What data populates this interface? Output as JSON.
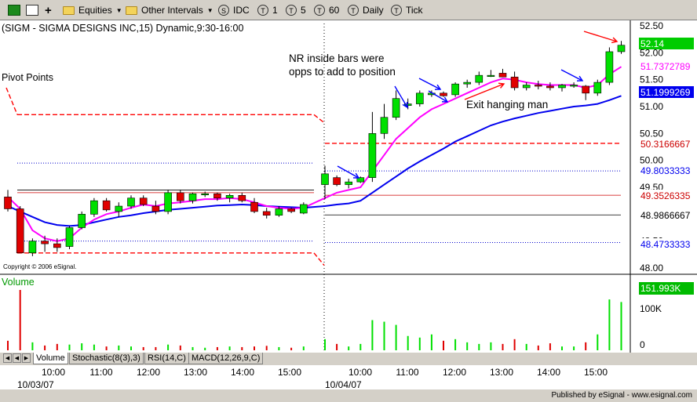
{
  "toolbar": {
    "equities_label": "Equities",
    "other_intervals_label": "Other Intervals",
    "idc_label": "IDC",
    "intervals": [
      "1",
      "5",
      "60",
      "Daily",
      "Tick"
    ],
    "icons": [
      "chart-window-icon",
      "page-setup-icon",
      "add-icon",
      "folder-icon",
      "source-icon",
      "interval-icon"
    ]
  },
  "chart": {
    "title": "(SIGM - SIGMA DESIGNS INC,15) Dynamic,9:30-16:00",
    "pivot_label": "Pivot Points",
    "copyright": "Copyright © 2006 eSignal.",
    "volume_label": "Volume",
    "annotations": [
      "NR inside bars were",
      "opps to add to position",
      "Exit hanging man"
    ],
    "colors": {
      "up": "#00e000",
      "down": "#e00000",
      "ma_fast": "#ff00ff",
      "ma_slow": "#0000ee",
      "pivot_red": "#ff0000",
      "pivot_blue": "#0000cc",
      "arrow_blue": "#0000ff",
      "arrow_red": "#ff0000",
      "volume_label": "#009900"
    }
  },
  "chart_data": {
    "type": "candlestick",
    "symbol": "SIGM",
    "interval": "15",
    "x_labels": [
      "10:00",
      "11:00",
      "12:00",
      "13:00",
      "14:00",
      "15:00",
      "10:00",
      "11:00",
      "12:00",
      "13:00",
      "14:00",
      "15:00"
    ],
    "date_labels": [
      "10/03/07",
      "10/04/07"
    ],
    "y_ticks": [
      "52.50",
      "52.00",
      "51.50",
      "51.00",
      "50.50",
      "50.00",
      "49.50",
      "49.00",
      "48.50",
      "48.00"
    ],
    "ylim": [
      48.0,
      52.6
    ],
    "volume_ticks": [
      "100K",
      "0"
    ],
    "value_tags": [
      {
        "value": "52.14",
        "color": "#00cc00",
        "text": "#ffffff"
      },
      {
        "value": "51.7372789",
        "color": "#ffffff",
        "text": "#ff00ff"
      },
      {
        "value": "51.1999269",
        "color": "#0000ee",
        "text": "#ffffff"
      },
      {
        "value": "50.3166667",
        "color": "#ffffff",
        "text": "#cc0000"
      },
      {
        "value": "49.8033333",
        "color": "#ffffff",
        "text": "#0000ee"
      },
      {
        "value": "49.3526335",
        "color": "#ffffff",
        "text": "#cc0000"
      },
      {
        "value": "48.9866667",
        "color": "#ffffff",
        "text": "#000000"
      },
      {
        "value": "48.4733333",
        "color": "#ffffff",
        "text": "#0000ee"
      }
    ],
    "last_volume": "151.993K",
    "candles": [
      {
        "o": 49.32,
        "h": 49.45,
        "l": 49.05,
        "c": 49.1,
        "v": 30
      },
      {
        "o": 49.1,
        "h": 49.15,
        "l": 48.28,
        "c": 48.28,
        "v": 190
      },
      {
        "o": 48.28,
        "h": 48.55,
        "l": 48.22,
        "c": 48.5,
        "v": 25
      },
      {
        "o": 48.5,
        "h": 48.6,
        "l": 48.3,
        "c": 48.45,
        "v": 15
      },
      {
        "o": 48.45,
        "h": 48.55,
        "l": 48.3,
        "c": 48.38,
        "v": 20
      },
      {
        "o": 48.4,
        "h": 48.78,
        "l": 48.35,
        "c": 48.75,
        "v": 18
      },
      {
        "o": 48.75,
        "h": 49.05,
        "l": 48.72,
        "c": 49.0,
        "v": 22
      },
      {
        "o": 49.0,
        "h": 49.3,
        "l": 48.95,
        "c": 49.25,
        "v": 18
      },
      {
        "o": 49.25,
        "h": 49.3,
        "l": 49.05,
        "c": 49.08,
        "v": 12
      },
      {
        "o": 49.05,
        "h": 49.22,
        "l": 48.95,
        "c": 49.15,
        "v": 15
      },
      {
        "o": 49.15,
        "h": 49.35,
        "l": 49.1,
        "c": 49.3,
        "v": 12
      },
      {
        "o": 49.3,
        "h": 49.35,
        "l": 49.15,
        "c": 49.18,
        "v": 10
      },
      {
        "o": 49.15,
        "h": 49.25,
        "l": 49.0,
        "c": 49.05,
        "v": 10
      },
      {
        "o": 49.05,
        "h": 49.45,
        "l": 49.0,
        "c": 49.4,
        "v": 18
      },
      {
        "o": 49.4,
        "h": 49.45,
        "l": 49.2,
        "c": 49.25,
        "v": 15
      },
      {
        "o": 49.25,
        "h": 49.4,
        "l": 49.2,
        "c": 49.38,
        "v": 10
      },
      {
        "o": 49.38,
        "h": 49.42,
        "l": 49.32,
        "c": 49.38,
        "v": 8
      },
      {
        "o": 49.38,
        "h": 49.4,
        "l": 49.25,
        "c": 49.3,
        "v": 10
      },
      {
        "o": 49.3,
        "h": 49.38,
        "l": 49.22,
        "c": 49.35,
        "v": 12
      },
      {
        "o": 49.35,
        "h": 49.4,
        "l": 49.22,
        "c": 49.25,
        "v": 10
      },
      {
        "o": 49.22,
        "h": 49.3,
        "l": 49.02,
        "c": 49.05,
        "v": 12
      },
      {
        "o": 49.05,
        "h": 49.12,
        "l": 48.92,
        "c": 48.98,
        "v": 14
      },
      {
        "o": 48.98,
        "h": 49.15,
        "l": 48.95,
        "c": 49.1,
        "v": 10
      },
      {
        "o": 49.1,
        "h": 49.12,
        "l": 49.02,
        "c": 49.05,
        "v": 8
      },
      {
        "o": 49.02,
        "h": 49.22,
        "l": 49.0,
        "c": 49.18,
        "v": 12
      },
      {
        "o": 49.55,
        "h": 49.9,
        "l": 49.28,
        "c": 49.75,
        "v": 35
      },
      {
        "o": 49.68,
        "h": 49.72,
        "l": 49.52,
        "c": 49.55,
        "v": 20
      },
      {
        "o": 49.55,
        "h": 49.66,
        "l": 49.48,
        "c": 49.6,
        "v": 12
      },
      {
        "o": 49.6,
        "h": 49.7,
        "l": 49.58,
        "c": 49.68,
        "v": 20
      },
      {
        "o": 49.68,
        "h": 50.9,
        "l": 49.6,
        "c": 50.5,
        "v": 95
      },
      {
        "o": 50.5,
        "h": 51.05,
        "l": 50.4,
        "c": 50.8,
        "v": 90
      },
      {
        "o": 50.8,
        "h": 51.3,
        "l": 50.75,
        "c": 51.15,
        "v": 80
      },
      {
        "o": 51.02,
        "h": 51.15,
        "l": 50.95,
        "c": 51.05,
        "v": 45
      },
      {
        "o": 51.05,
        "h": 51.3,
        "l": 51.0,
        "c": 51.25,
        "v": 40
      },
      {
        "o": 51.22,
        "h": 51.3,
        "l": 51.18,
        "c": 51.25,
        "v": 50
      },
      {
        "o": 51.25,
        "h": 51.28,
        "l": 51.18,
        "c": 51.2,
        "v": 30
      },
      {
        "o": 51.22,
        "h": 51.45,
        "l": 51.18,
        "c": 51.42,
        "v": 35
      },
      {
        "o": 51.42,
        "h": 51.5,
        "l": 51.35,
        "c": 51.45,
        "v": 25
      },
      {
        "o": 51.45,
        "h": 51.65,
        "l": 51.4,
        "c": 51.58,
        "v": 20
      },
      {
        "o": 51.58,
        "h": 51.68,
        "l": 51.55,
        "c": 51.58,
        "v": 25
      },
      {
        "o": 51.62,
        "h": 51.7,
        "l": 51.55,
        "c": 51.55,
        "v": 20
      },
      {
        "o": 51.55,
        "h": 51.65,
        "l": 51.3,
        "c": 51.35,
        "v": 35
      },
      {
        "o": 51.35,
        "h": 51.45,
        "l": 51.3,
        "c": 51.4,
        "v": 20
      },
      {
        "o": 51.4,
        "h": 51.48,
        "l": 51.32,
        "c": 51.38,
        "v": 15
      },
      {
        "o": 51.38,
        "h": 51.45,
        "l": 51.3,
        "c": 51.35,
        "v": 22
      },
      {
        "o": 51.35,
        "h": 51.42,
        "l": 51.28,
        "c": 51.4,
        "v": 12
      },
      {
        "o": 51.4,
        "h": 51.45,
        "l": 51.35,
        "c": 51.4,
        "v": 12
      },
      {
        "o": 51.38,
        "h": 51.4,
        "l": 51.12,
        "c": 51.25,
        "v": 25
      },
      {
        "o": 51.25,
        "h": 51.5,
        "l": 51.2,
        "c": 51.45,
        "v": 50
      },
      {
        "o": 51.45,
        "h": 52.1,
        "l": 51.4,
        "c": 52.02,
        "v": 160
      },
      {
        "o": 52.02,
        "h": 52.22,
        "l": 51.98,
        "c": 52.14,
        "v": 152
      }
    ],
    "ma_fast": [
      49.32,
      49.1,
      48.7,
      48.55,
      48.5,
      48.55,
      48.75,
      48.9,
      49.0,
      49.05,
      49.12,
      49.18,
      49.15,
      49.2,
      49.22,
      49.25,
      49.28,
      49.28,
      49.3,
      49.28,
      49.22,
      49.15,
      49.12,
      49.1,
      49.12,
      49.3,
      49.4,
      49.45,
      49.5,
      49.8,
      50.1,
      50.4,
      50.6,
      50.8,
      50.95,
      51.05,
      51.15,
      51.25,
      51.35,
      51.45,
      51.52,
      51.5,
      51.45,
      51.42,
      51.4,
      51.4,
      51.4,
      51.35,
      51.4,
      51.6,
      51.74
    ],
    "ma_slow": [
      49.15,
      49.05,
      48.95,
      48.85,
      48.8,
      48.78,
      48.8,
      48.85,
      48.9,
      48.95,
      48.98,
      49.02,
      49.05,
      49.08,
      49.1,
      49.12,
      49.14,
      49.16,
      49.17,
      49.18,
      49.17,
      49.15,
      49.14,
      49.13,
      49.12,
      49.15,
      49.18,
      49.2,
      49.25,
      49.4,
      49.55,
      49.7,
      49.85,
      49.98,
      50.1,
      50.22,
      50.35,
      50.45,
      50.55,
      50.65,
      50.72,
      50.78,
      50.83,
      50.88,
      50.92,
      50.96,
      51.0,
      51.02,
      51.05,
      51.12,
      51.2
    ],
    "pivots_day1": {
      "R1": 50.85,
      "PP_upper": 49.95,
      "PP": 49.4,
      "S1": 48.5,
      "S2": 48.28
    },
    "pivots_day2": {
      "R1": 50.3166667,
      "PP_upper": 49.8033333,
      "PP": 49.3526335,
      "S1": 48.9866667,
      "S2": 48.4733333
    }
  },
  "tabs": [
    "Volume",
    "Stochastic(8(3),3)",
    "RSI(14,C)",
    "MACD(12,26,9,C)"
  ],
  "status": "Published by eSignal - www.esignal.com"
}
